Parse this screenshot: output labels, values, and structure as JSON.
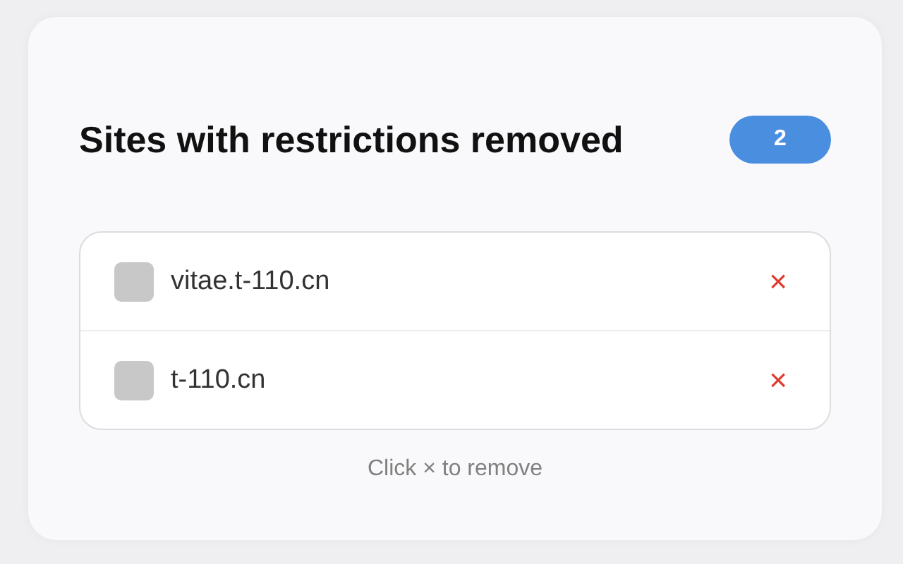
{
  "header": {
    "title": "Sites with restrictions removed",
    "count": "2"
  },
  "sites": [
    {
      "domain": "vitae.t-110.cn",
      "remove": "×"
    },
    {
      "domain": "t-110.cn",
      "remove": "×"
    }
  ],
  "hint": "Click × to remove"
}
